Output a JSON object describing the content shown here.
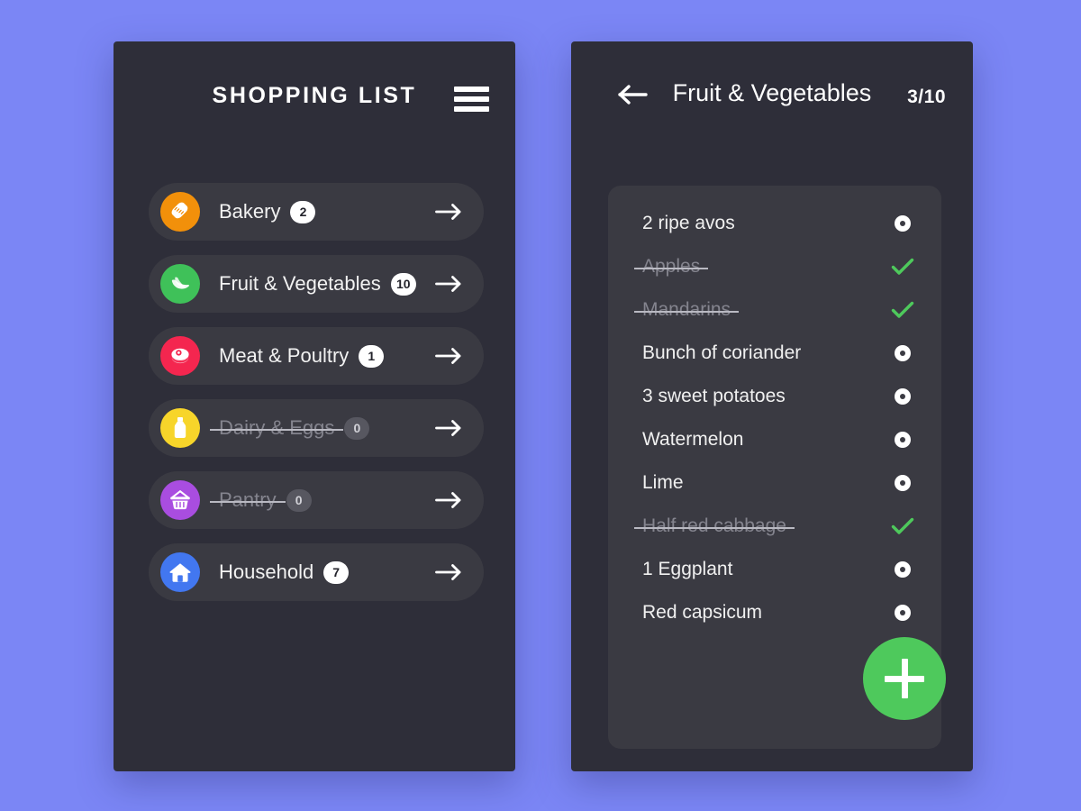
{
  "theme": {
    "page_background": "#7b86f5",
    "panel_background": "#2e2e39",
    "card_background": "#3a3a42",
    "accent_green": "#4ec95c",
    "text_primary": "#f2f2f2",
    "text_muted": "#84848e"
  },
  "list_screen": {
    "title": "SHOPPING LIST",
    "menu_icon": "hamburger-menu-icon",
    "categories": [
      {
        "label": "Bakery",
        "count": "2",
        "icon": "bread-icon",
        "icon_color": "#f2900a",
        "done": false,
        "arrow": "arrow-right-icon"
      },
      {
        "label": "Fruit & Vegetables",
        "count": "10",
        "icon": "banana-icon",
        "icon_color": "#3fc159",
        "done": false,
        "arrow": "arrow-right-icon"
      },
      {
        "label": "Meat & Poultry",
        "count": "1",
        "icon": "steak-icon",
        "icon_color": "#f4264f",
        "done": false,
        "arrow": "arrow-right-icon"
      },
      {
        "label": "Dairy & Eggs",
        "count": "0",
        "icon": "milk-bottle-icon",
        "icon_color": "#f7d52a",
        "done": true,
        "arrow": "arrow-right-icon"
      },
      {
        "label": "Pantry",
        "count": "0",
        "icon": "basket-icon",
        "icon_color": "#a94de0",
        "done": true,
        "arrow": "arrow-right-icon"
      },
      {
        "label": "Household",
        "count": "7",
        "icon": "house-icon",
        "icon_color": "#4277f0",
        "done": false,
        "arrow": "arrow-right-icon"
      }
    ]
  },
  "detail_screen": {
    "back_icon": "arrow-left-icon",
    "title": "Fruit & Vegetables",
    "progress": "3/10",
    "add_button_icon": "plus-icon",
    "items": [
      {
        "label": "2 ripe avos",
        "done": false,
        "mark": "circle-dot-icon"
      },
      {
        "label": "Apples",
        "done": true,
        "mark": "check-icon"
      },
      {
        "label": "Mandarins",
        "done": true,
        "mark": "check-icon"
      },
      {
        "label": "Bunch of coriander",
        "done": false,
        "mark": "circle-dot-icon"
      },
      {
        "label": "3 sweet potatoes",
        "done": false,
        "mark": "circle-dot-icon"
      },
      {
        "label": "Watermelon",
        "done": false,
        "mark": "circle-dot-icon"
      },
      {
        "label": "Lime",
        "done": false,
        "mark": "circle-dot-icon"
      },
      {
        "label": "Half red cabbage",
        "done": true,
        "mark": "check-icon"
      },
      {
        "label": "1 Eggplant",
        "done": false,
        "mark": "circle-dot-icon"
      },
      {
        "label": "Red capsicum",
        "done": false,
        "mark": "circle-dot-icon"
      }
    ]
  }
}
